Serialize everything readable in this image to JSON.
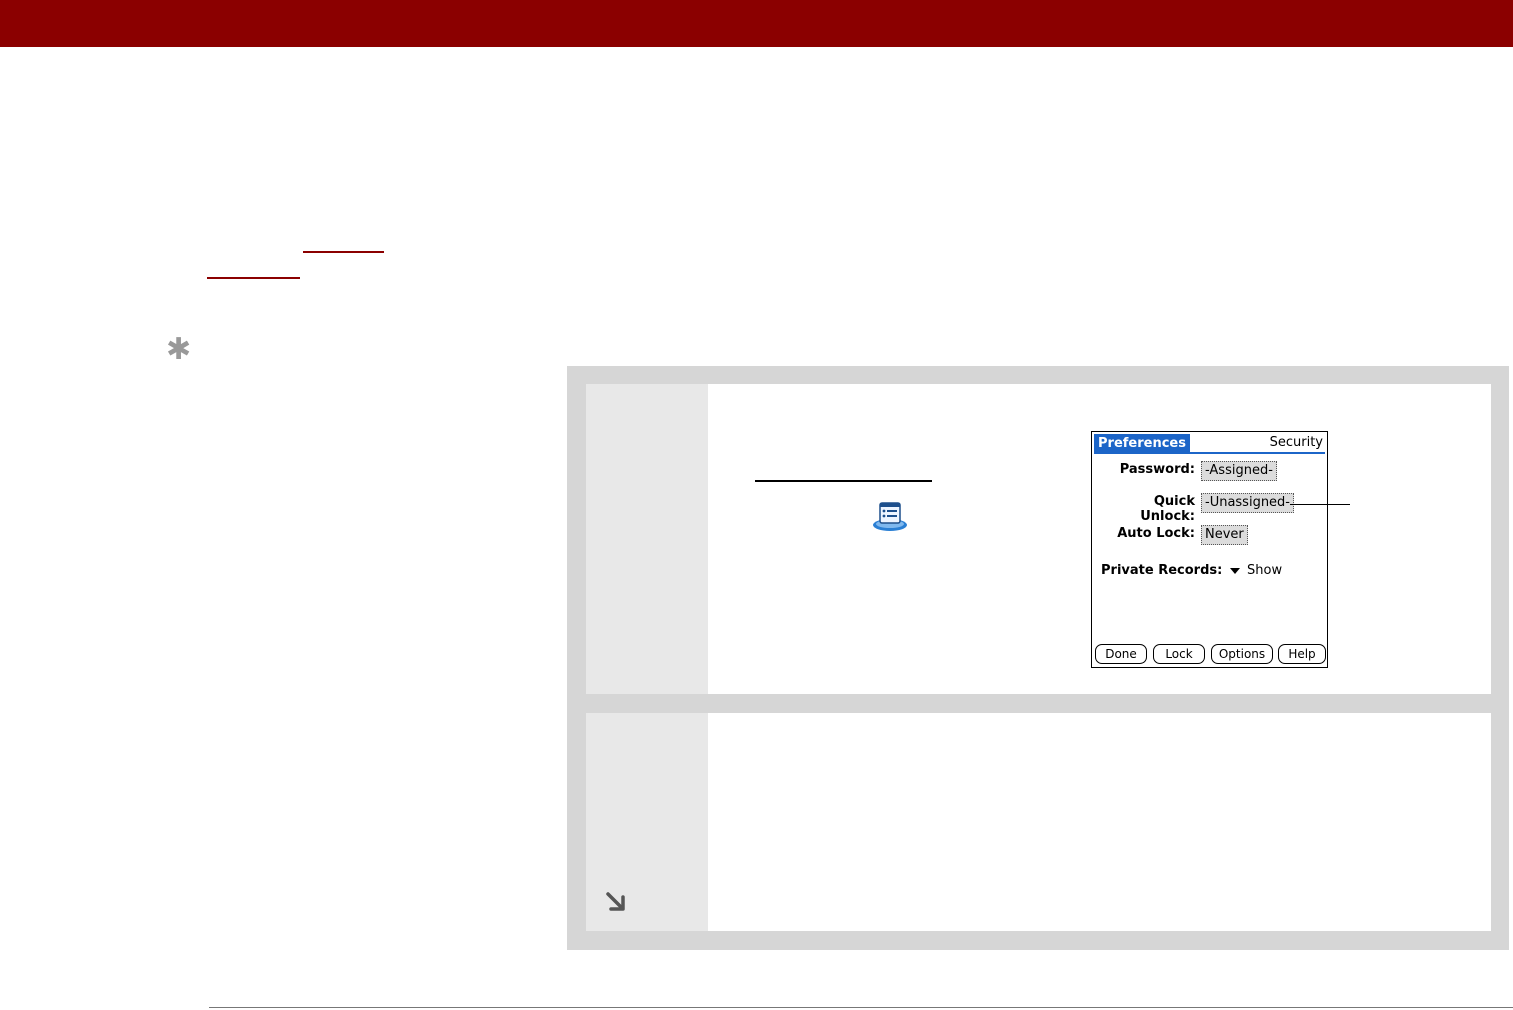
{
  "header": {
    "color": "#8b0000"
  },
  "tip": {
    "icon": "asterisk-icon"
  },
  "steps": {
    "step1": {
      "icon": "prefs-app-icon"
    },
    "step2": {
      "icon": "continue-arrow-icon"
    }
  },
  "device": {
    "title": "Preferences",
    "section": "Security",
    "accent_color": "#1c65c8",
    "fields": [
      {
        "label": "Password:",
        "value": "-Assigned-"
      },
      {
        "label": "Quick Unlock:",
        "value": "-Unassigned-"
      },
      {
        "label": "Auto Lock:",
        "value": "Never"
      }
    ],
    "private_records": {
      "label": "Private Records:",
      "value": "Show"
    },
    "buttons": [
      "Done",
      "Lock",
      "Options",
      "Help"
    ]
  }
}
